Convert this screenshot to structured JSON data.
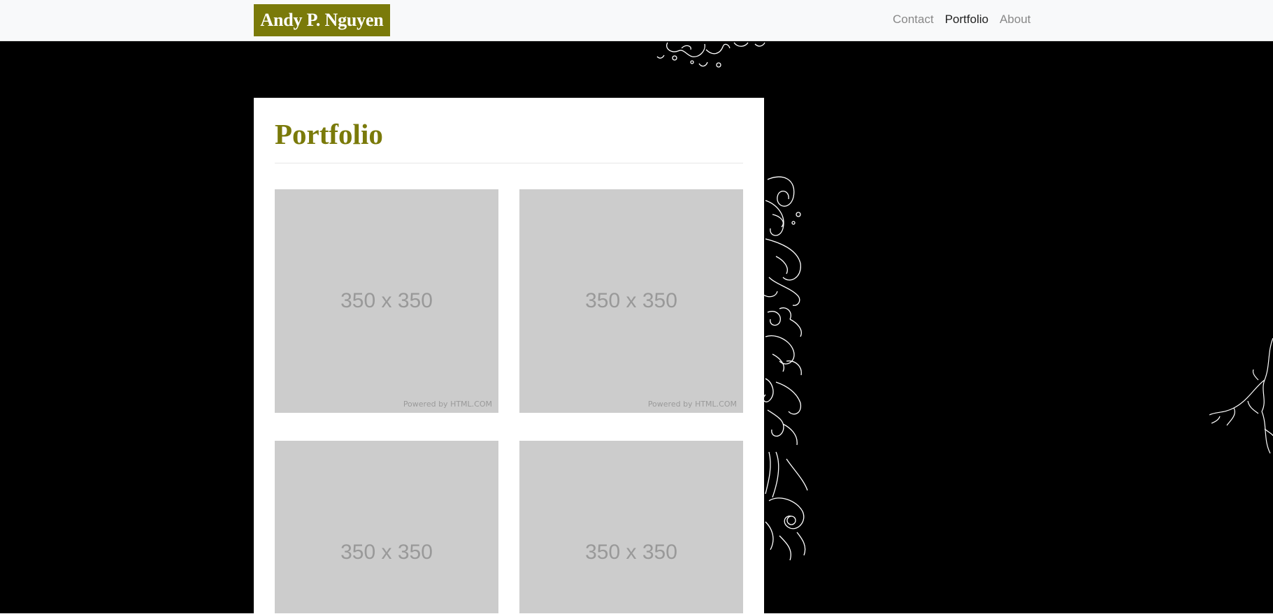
{
  "navbar": {
    "brand": "Andy P. Nguyen",
    "links": [
      {
        "label": "Contact",
        "active": false
      },
      {
        "label": "Portfolio",
        "active": true
      },
      {
        "label": "About",
        "active": false
      }
    ]
  },
  "main": {
    "title": "Portfolio",
    "thumbnails": [
      {
        "size_label": "350 x 350",
        "powered_label": "Powered by HTML.COM"
      },
      {
        "size_label": "350 x 350",
        "powered_label": "Powered by HTML.COM"
      },
      {
        "size_label": "350 x 350",
        "powered_label": ""
      },
      {
        "size_label": "350 x 350",
        "powered_label": ""
      }
    ]
  },
  "colors": {
    "brand_bg": "#7a7a0a",
    "title": "#7a7a0a",
    "placeholder_bg": "#cccccc",
    "page_bg": "#000000"
  }
}
